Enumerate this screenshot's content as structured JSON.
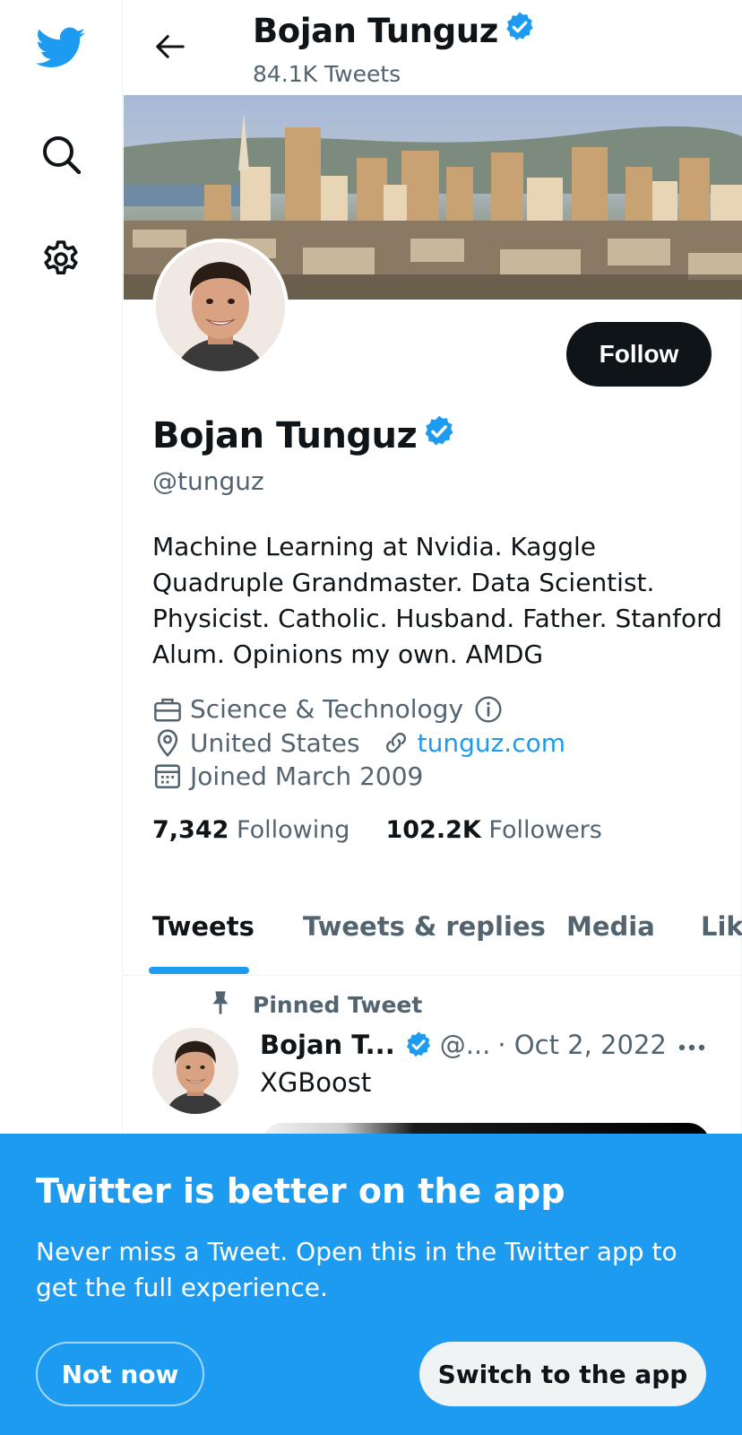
{
  "colors": {
    "accent": "#1d9bf0",
    "text": "#0f1419",
    "muted": "#536471",
    "follow_bg": "#0f1419"
  },
  "nav": {
    "logo_icon": "twitter-bird-icon",
    "search_icon": "search-icon",
    "settings_icon": "gear-icon"
  },
  "header": {
    "name": "Bojan Tunguz",
    "tweet_count": "84.1K Tweets"
  },
  "profile": {
    "name": "Bojan Tunguz",
    "handle": "@tunguz",
    "follow_label": "Follow",
    "bio": "Machine Learning at Nvidia. Kaggle Quadruple Grandmaster. Data Scientist. Physicist. Catholic. Husband. Father. Stanford Alum. Opinions my own. AMDG",
    "category": "Science & Technology",
    "location": "United States",
    "website": "tunguz.com",
    "joined": "Joined March 2009",
    "following_count": "7,342",
    "following_label": "Following",
    "followers_count": "102.2K",
    "followers_label": "Followers"
  },
  "tabs": [
    {
      "label": "Tweets",
      "active": true
    },
    {
      "label": "Tweets & replies",
      "active": false
    },
    {
      "label": "Media",
      "active": false
    },
    {
      "label": "Likes",
      "active": false
    }
  ],
  "tweet": {
    "pinned_label": "Pinned Tweet",
    "author": "Bojan T...",
    "handle": "@...",
    "date": "· Oct 2, 2022",
    "text": "XGBoost"
  },
  "app_prompt": {
    "title": "Twitter is better on the app",
    "text": "Never miss a Tweet. Open this in the Twitter app to get the full experience.",
    "not_now_label": "Not now",
    "switch_label": "Switch to the app"
  }
}
